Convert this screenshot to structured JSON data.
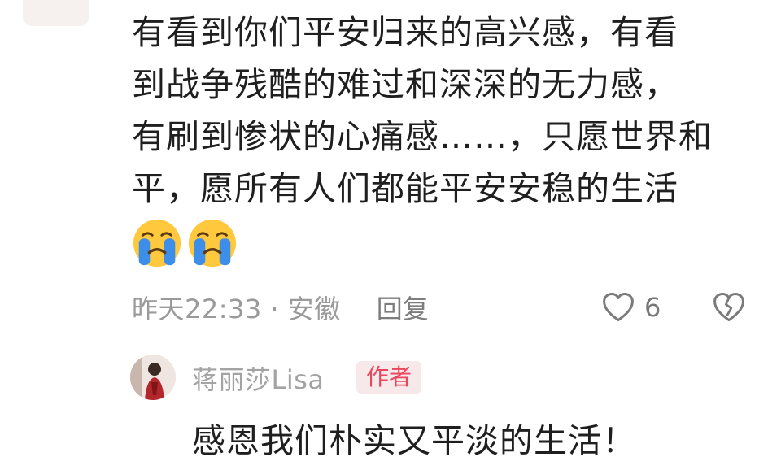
{
  "comment": {
    "lines": [
      "有看到你们平安归来的高兴感，有看",
      "到战争残酷的难过和深深的无力感，",
      "有刷到惨状的心痛感……，只愿世界和",
      "平，愿所有人们都能平安安稳的生活"
    ],
    "emojis": [
      "crying-face",
      "crying-face"
    ],
    "meta": {
      "timestamp_location": "昨天22:33 · 安徽",
      "reply_label": "回复",
      "like_count": "6"
    }
  },
  "reply": {
    "author": "蒋丽莎Lisa",
    "badge": "作者",
    "text": "感恩我们朴实又平淡的生活！"
  },
  "colors": {
    "text": "#1f1f1f",
    "meta_gray": "#9a9a9a",
    "badge_text": "#e8475e",
    "badge_bg": "#f7e8ea",
    "emoji_yellow": "#ffc83d",
    "emoji_tear": "#3d8ee8"
  }
}
